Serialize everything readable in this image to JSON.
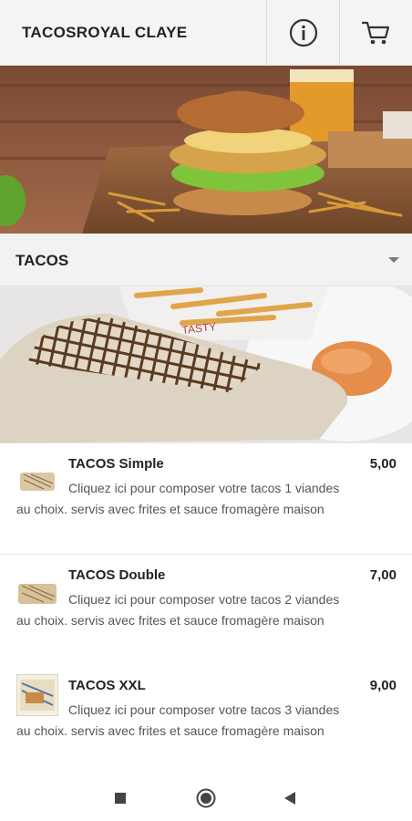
{
  "header": {
    "title": "TACOSROYAL CLAYE",
    "info_icon": "info-icon",
    "cart_icon": "cart-icon"
  },
  "hero": {
    "image": "burger-hero-image"
  },
  "category": {
    "label": "TACOS",
    "dropdown_icon": "chevron-down-icon",
    "image": "tacos-category-image"
  },
  "items": [
    {
      "name": "TACOS Simple",
      "price": "5,00",
      "description": "Cliquez ici pour composer votre tacos 1 viandes au choix. servis avec frites et sauce fromagère maison"
    },
    {
      "name": "TACOS Double",
      "price": "7,00",
      "description": "Cliquez ici pour composer votre tacos 2 viandes au choix. servis avec frites et sauce fromagère maison"
    },
    {
      "name": "TACOS XXL",
      "price": "9,00",
      "description": "Cliquez ici pour composer votre tacos 3 viandes au choix. servis avec frites et sauce fromagère maison"
    }
  ],
  "navbar": {
    "recents_icon": "square-icon",
    "home_icon": "circle-icon",
    "back_icon": "triangle-back-icon"
  },
  "colors": {
    "header_bg": "#f4f4f4",
    "category_bg": "#f2f2f2",
    "text": "#222222",
    "description": "#555555"
  }
}
